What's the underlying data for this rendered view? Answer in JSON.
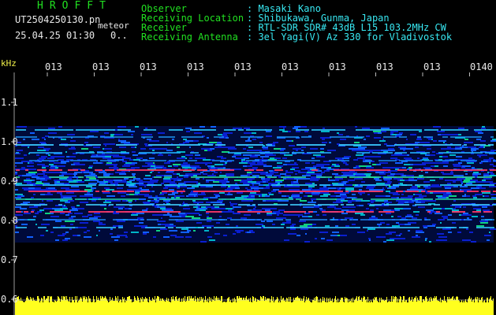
{
  "header": {
    "brand": "HROFFT",
    "filename": "UT2504250130.pn",
    "tag": "meteor",
    "datetime": "25.04.25 01:30",
    "detection_count": "0.."
  },
  "meta": [
    {
      "label": "Observer",
      "value": ": Masaki Kano"
    },
    {
      "label": "Receiving Location",
      "value": ": Shibukawa, Gunma, Japan"
    },
    {
      "label": "Receiver",
      "value": ": RTL-SDR SDR# 43dB L15 103.2MHz CW"
    },
    {
      "label": "Receiving Antenna",
      "value": ": 3el Yagi(V) Az 330 for Vladivostok"
    }
  ],
  "y_axis": {
    "unit": "kHz",
    "labels": [
      "1.1",
      "1.0",
      "0.9",
      "0.8",
      "0.7",
      "0.6"
    ]
  },
  "x_axis": {
    "labels": [
      "013",
      "013",
      "013",
      "013",
      "013",
      "013",
      "013",
      "013",
      "013",
      "0140"
    ]
  },
  "colors": {
    "label": "#21e021",
    "value": "#38e8f2",
    "text": "#e8e8e8",
    "bars": "#ffff1e"
  }
}
